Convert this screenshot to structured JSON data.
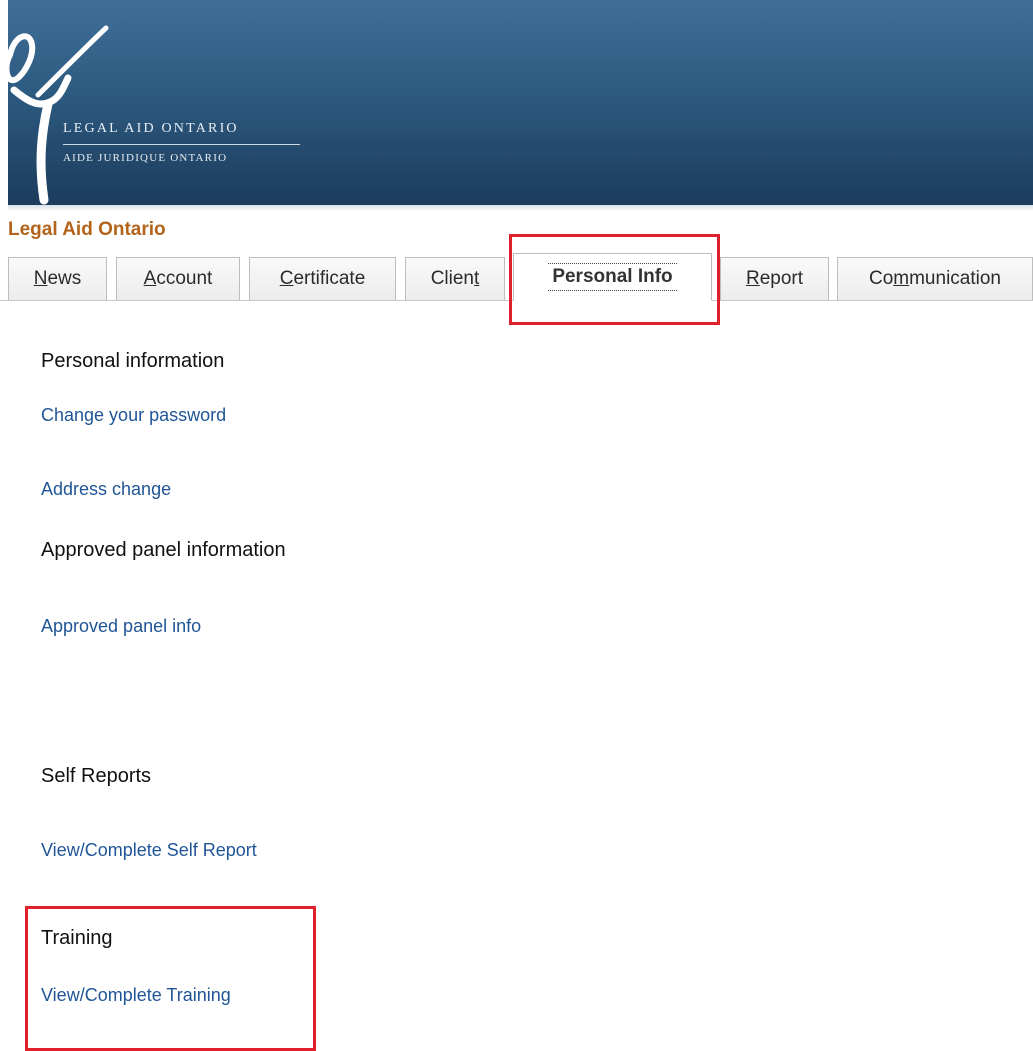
{
  "header": {
    "brand_en": "LEGAL AID ONTARIO",
    "brand_fr": "AIDE JURIDIQUE ONTARIO",
    "logo_icon": "stylized-figure-logo-icon",
    "site_title": "Legal Aid Ontario"
  },
  "tabs": [
    {
      "id": "news",
      "pre": "",
      "acc": "N",
      "post": "ews",
      "active": false
    },
    {
      "id": "account",
      "pre": "",
      "acc": "A",
      "post": "ccount",
      "active": false
    },
    {
      "id": "certificate",
      "pre": "",
      "acc": "C",
      "post": "ertificate",
      "active": false
    },
    {
      "id": "client",
      "pre": "Clien",
      "acc": "t",
      "post": "",
      "active": false
    },
    {
      "id": "personal-info",
      "label": "Personal Info",
      "active": true
    },
    {
      "id": "report",
      "pre": "",
      "acc": "R",
      "post": "eport",
      "active": false
    },
    {
      "id": "communication",
      "pre": "Co",
      "acc": "m",
      "post": "munication",
      "active": false
    }
  ],
  "sections": {
    "personal": {
      "heading": "Personal information",
      "links": [
        "Change your password",
        "Address change"
      ]
    },
    "panel": {
      "heading": "Approved panel information",
      "links": [
        "Approved panel info"
      ]
    },
    "self_reports": {
      "heading": "Self Reports",
      "links": [
        "View/Complete Self Report"
      ]
    },
    "training": {
      "heading": "Training",
      "links": [
        "View/Complete Training"
      ]
    }
  },
  "colors": {
    "banner": "#2d5a80",
    "site_title": "#b3641b",
    "link": "#1f5596",
    "highlight": "#e0202a"
  }
}
